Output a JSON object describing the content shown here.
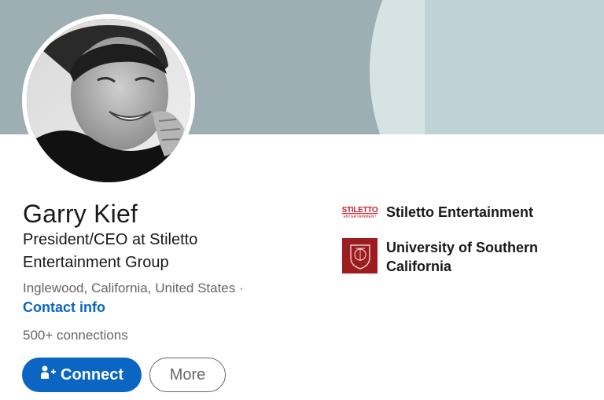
{
  "profile": {
    "name": "Garry Kief",
    "headline": "President/CEO at Stiletto Entertainment Group",
    "location": "Inglewood, California, United States ·",
    "contact_info": "Contact info",
    "connections": "500+ connections"
  },
  "actions": {
    "connect_label": "Connect",
    "more_label": "More"
  },
  "experience": [
    {
      "name": "Stiletto Entertainment",
      "logo_text_1": "STILETTO",
      "logo_text_2": "ENTERTAINMENT"
    },
    {
      "name": "University of Southern California",
      "logo_icon": "usc-seal-icon"
    }
  ],
  "colors": {
    "brand_blue": "#0a66c2",
    "banner": "#9dafb3",
    "usc_red": "#9d1c1f",
    "stiletto_red": "#c3202e"
  }
}
